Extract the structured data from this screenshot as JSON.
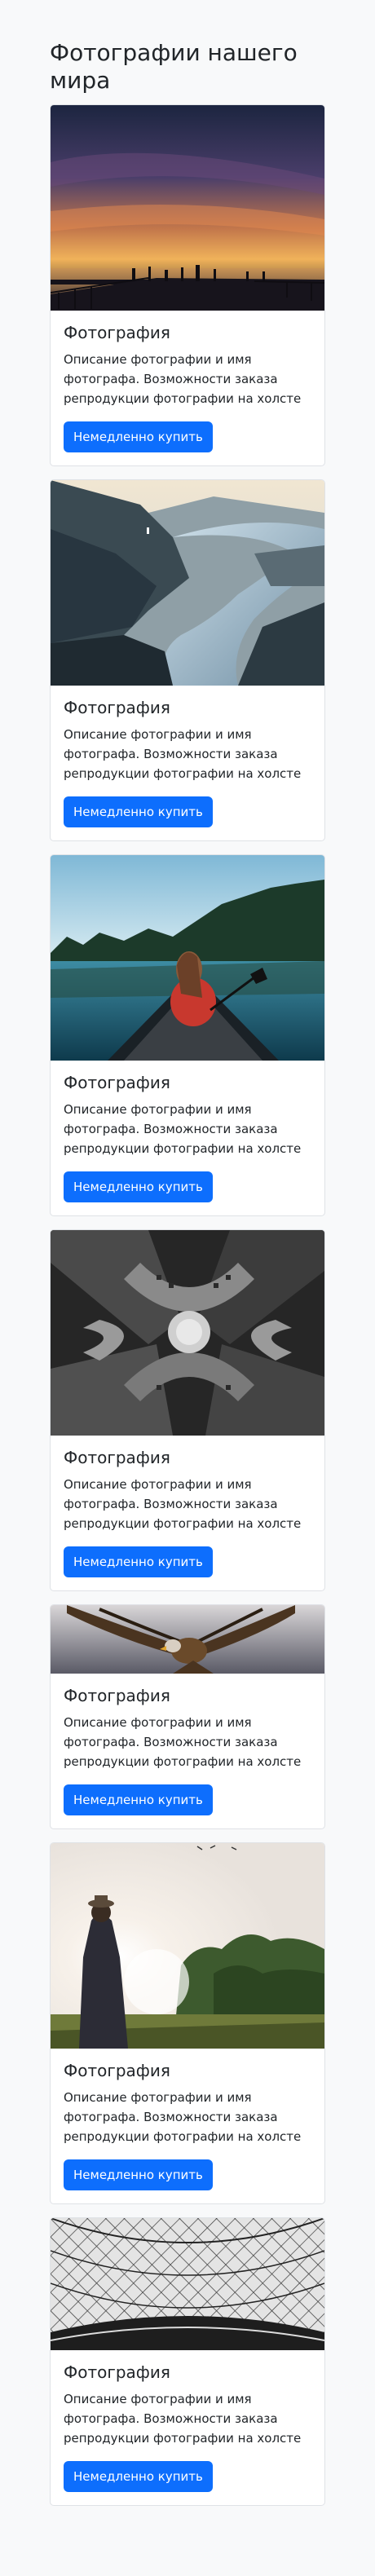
{
  "page": {
    "title": "Фотографии нашего мира"
  },
  "cards": [
    {
      "title": "Фотография",
      "text": "Описание фотографии и имя фотографа. Возможности заказа репродукции фотографии на холсте",
      "button": "Немедленно купить",
      "image": "sunset-pier-photo"
    },
    {
      "title": "Фотография",
      "text": "Описание фотографии и имя фотографа. Возможности заказа репродукции фотографии на холсте",
      "button": "Немедленно купить",
      "image": "fjord-cliff-photo"
    },
    {
      "title": "Фотография",
      "text": "Описание фотографии и имя фотографа. Возможности заказа репродукции фотографии на холсте",
      "button": "Немедленно купить",
      "image": "canoe-lake-photo"
    },
    {
      "title": "Фотография",
      "text": "Описание фотографии и имя фотографа. Возможности заказа репродукции фотографии на холсте",
      "button": "Немедленно купить",
      "image": "arches-bw-photo"
    },
    {
      "title": "Фотография",
      "text": "Описание фотографии и имя фотографа. Возможности заказа репродукции фотографии на холсте",
      "button": "Немедленно купить",
      "image": "eagle-photo"
    },
    {
      "title": "Фотография",
      "text": "Описание фотографии и имя фотографа. Возможности заказа репродукции фотографии на холсте",
      "button": "Немедленно купить",
      "image": "man-sunlight-photo"
    },
    {
      "title": "Фотография",
      "text": "Описание фотографии и имя фотографа. Возможности заказа репродукции фотографии на холсте",
      "button": "Немедленно купить",
      "image": "glass-dome-photo"
    }
  ],
  "colors": {
    "background": "#f8f9fa",
    "button": "#0d6efd",
    "button_text": "#ffffff",
    "card_border": "#dfe2e6"
  }
}
